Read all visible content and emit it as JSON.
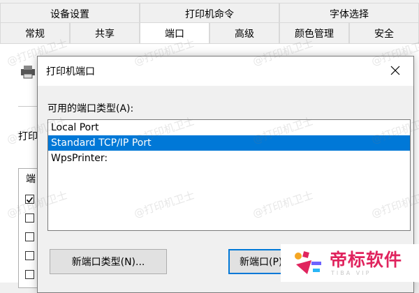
{
  "background_window": {
    "tabs_top": [
      "设备设置",
      "打印机命令",
      "字体选择"
    ],
    "tabs_bottom": [
      "常规",
      "共享",
      "端口",
      "高级",
      "颜色管理",
      "安全"
    ],
    "active_tab_index": 2,
    "partial_label_print": "打印",
    "partial_column_header": "端"
  },
  "dialog": {
    "title": "打印机端口",
    "available_label": "可用的端口类型(A):",
    "port_types": [
      "Local Port",
      "Standard TCP/IP Port",
      "WpsPrinter:"
    ],
    "selected_index": 1,
    "new_port_type_button": "新端口类型(N)...",
    "new_port_button": "新端口(P)..."
  },
  "watermark": "@打印机卫士",
  "logo": {
    "name": "帝标软件",
    "sub": "TIBA VIP"
  },
  "colors": {
    "selection": "#0078d7",
    "logo_text": "#e0245e"
  }
}
